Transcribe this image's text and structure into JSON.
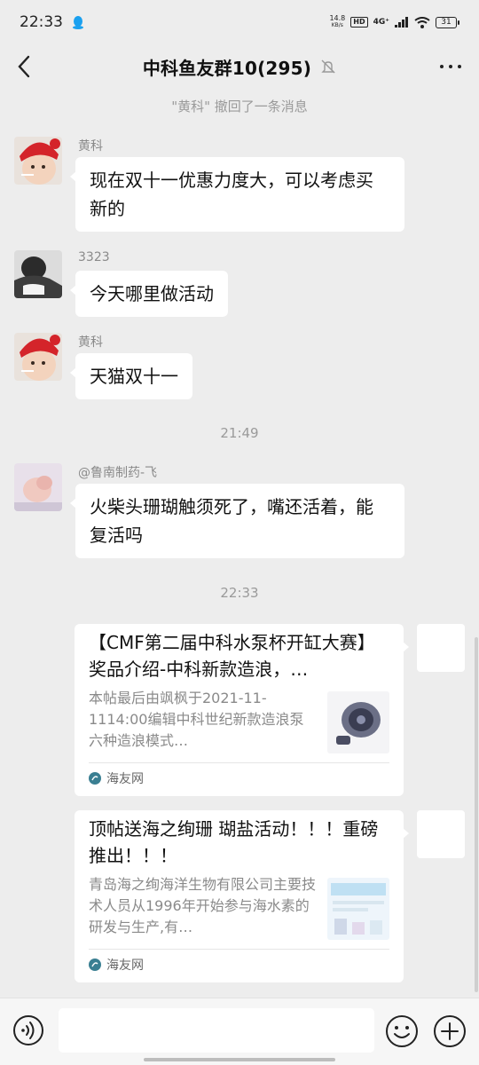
{
  "status_bar": {
    "time": "22:33",
    "net_speed_value": "14.8",
    "net_speed_unit": "KB/s",
    "hd": "HD",
    "network": "4G⁺",
    "battery": "31"
  },
  "header": {
    "title": "中科鱼友群10(295)"
  },
  "system_message": "\"黄科\" 撤回了一条消息",
  "messages": [
    {
      "sender": "黄科",
      "text": "现在双十一优惠力度大，可以考虑买新的"
    },
    {
      "sender": "3323",
      "text": "今天哪里做活动"
    },
    {
      "sender": "黄科",
      "text": "天猫双十一"
    },
    {
      "sender": "@鲁南制药-飞",
      "text": "火柴头珊瑚触须死了，嘴还活着，能复活吗"
    }
  ],
  "timestamps": [
    "21:49",
    "22:33"
  ],
  "cards": [
    {
      "title": "【CMF第二届中科水泵杯开缸大赛】奖品介绍-中科新款造浪，…",
      "desc": "本帖最后由飒枫于2021-11-1114:00编辑中科世纪新款造浪泵六种造浪模式…",
      "source": "海友网"
    },
    {
      "title": "顶帖送海之绚珊 瑚盐活动！！！重磅推出！！！",
      "desc": "青岛海之绚海洋生物有限公司主要技术人员从1996年开始参与海水素的研发与生产,有…",
      "source": "海友网"
    }
  ],
  "colors": {
    "background": "#ededed",
    "bubble": "#ffffff",
    "meta_text": "#9a9a9a",
    "qq_blue": "#1aa0ef"
  }
}
